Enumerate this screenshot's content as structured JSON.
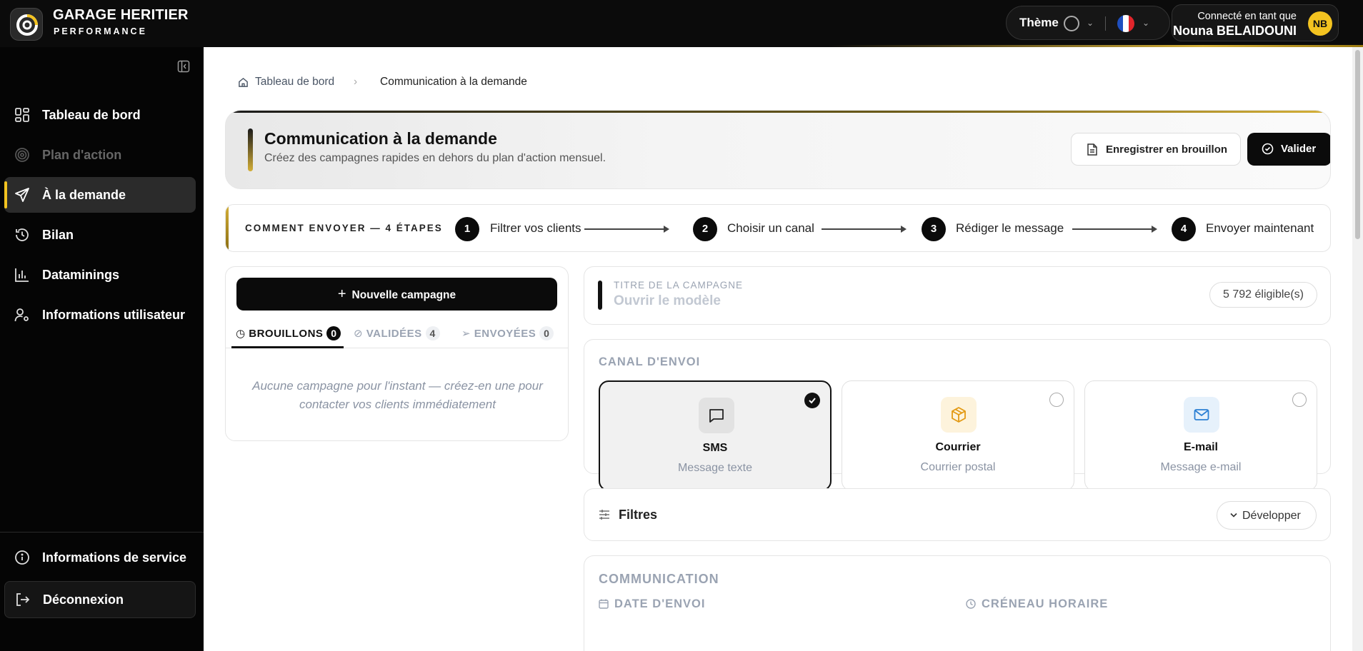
{
  "brand": {
    "name": "GARAGE HERITIER",
    "sub": "PERFORMANCE"
  },
  "header": {
    "theme_label": "Thème",
    "user_prefix": "Connecté en tant que",
    "user_name": "Nouna BELAIDOUNI",
    "user_initials": "NB"
  },
  "sidebar": {
    "items": [
      {
        "label": "Tableau de bord",
        "icon": "grid-icon"
      },
      {
        "label": "Plan d'action",
        "icon": "target-icon",
        "disabled": true
      },
      {
        "label": "À la demande",
        "icon": "send-icon",
        "active": true
      },
      {
        "label": "Bilan",
        "icon": "history-icon"
      },
      {
        "label": "Dataminings",
        "icon": "bar-chart-icon"
      },
      {
        "label": "Informations utilisateur",
        "icon": "user-settings-icon"
      }
    ],
    "service_info": "Informations de service",
    "logout": "Déconnexion"
  },
  "breadcrumb": {
    "home": "Tableau de bord",
    "current": "Communication à la demande"
  },
  "hero": {
    "title": "Communication à la demande",
    "subtitle": "Créez des campagnes rapides en dehors du plan d'action mensuel.",
    "draft_label": "Enregistrer en brouillon",
    "validate_label": "Valider"
  },
  "steps": {
    "title": "COMMENT ENVOYER — 4 ÉTAPES",
    "items": [
      {
        "num": "1",
        "label": "Filtrer vos clients"
      },
      {
        "num": "2",
        "label": "Choisir un canal"
      },
      {
        "num": "3",
        "label": "Rédiger le message"
      },
      {
        "num": "4",
        "label": "Envoyer maintenant"
      }
    ]
  },
  "campaigns": {
    "new_label": "Nouvelle campagne",
    "tabs": [
      {
        "label": "BROUILLONS",
        "count": "0"
      },
      {
        "label": "VALIDÉES",
        "count": "4"
      },
      {
        "label": "ENVOYÉES",
        "count": "0"
      }
    ],
    "empty": "Aucune campagne pour l'instant — créez-en une pour contacter vos clients immédiatement"
  },
  "campaign_title": {
    "label": "TITRE DE LA CAMPAGNE",
    "placeholder": "Ouvrir le modèle",
    "eligible": "5 792 éligible(s)"
  },
  "canal": {
    "heading": "CANAL D'ENVOI",
    "options": [
      {
        "name": "SMS",
        "desc": "Message texte",
        "icon": "message-icon",
        "selected": true
      },
      {
        "name": "Courrier",
        "desc": "Courrier postal",
        "icon": "package-icon",
        "selected": false
      },
      {
        "name": "E-mail",
        "desc": "Message e-mail",
        "icon": "mail-icon",
        "selected": false
      }
    ]
  },
  "filters": {
    "label": "Filtres",
    "expand_label": "Développer"
  },
  "communication": {
    "heading": "COMMUNICATION",
    "date_label": "DATE D'ENVOI",
    "slot_label": "CRÉNEAU HORAIRE"
  },
  "colors": {
    "accent": "#f3c320",
    "gold": "#d4af37",
    "dark": "#0b0b0b",
    "courrier_bg": "#fdf3dc",
    "email_bg": "#e6f1fb"
  }
}
